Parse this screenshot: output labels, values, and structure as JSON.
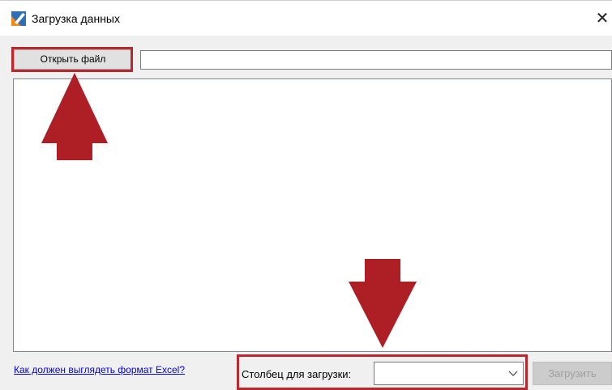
{
  "window": {
    "title": "Загрузка данных",
    "close_glyph": "✕",
    "icon": "app-logo-icon"
  },
  "toolbar": {
    "open_file_label": "Открыть файл",
    "path_value": ""
  },
  "footer": {
    "help_link": "Как должен выглядеть формат Excel?",
    "column_label": "Столбец для загрузки:",
    "column_value": "",
    "load_button": "Загрузить"
  },
  "colors": {
    "highlight": "#b8282e",
    "arrow": "#ad1f24",
    "link": "#0000ee"
  }
}
